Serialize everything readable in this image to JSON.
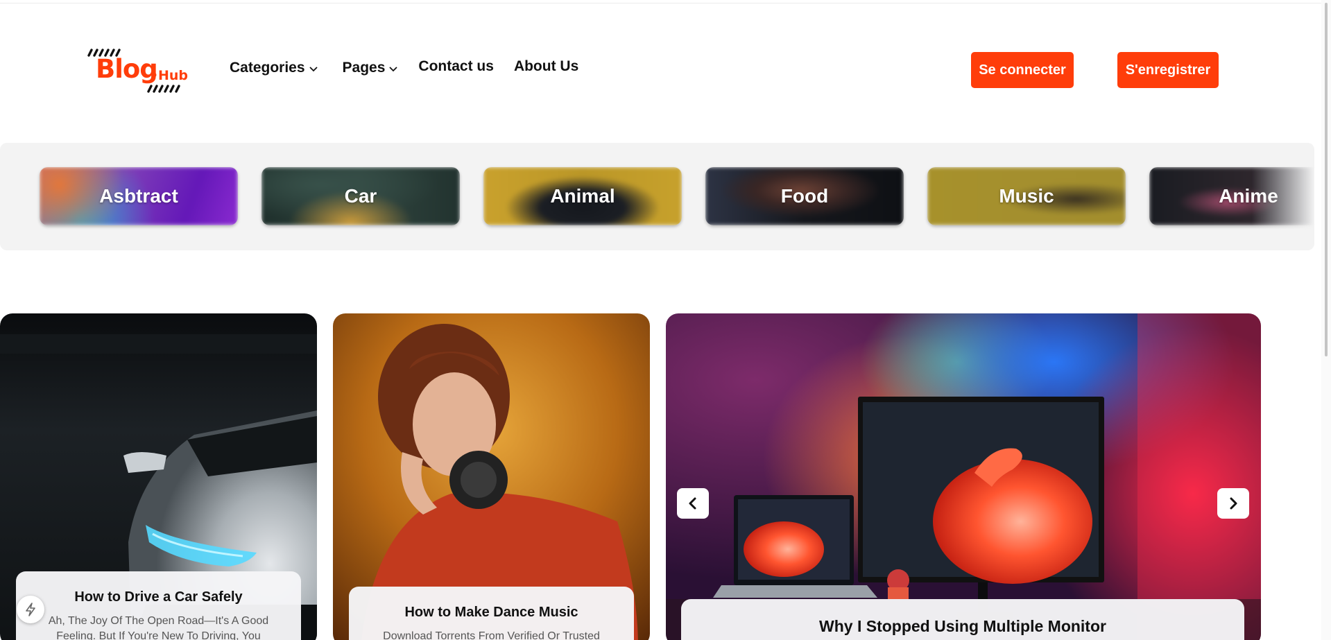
{
  "header": {
    "logo_text_main": "Blog",
    "logo_text_sub": "Hub",
    "nav": [
      {
        "label": "Categories",
        "has_dropdown": true
      },
      {
        "label": "Pages",
        "has_dropdown": true
      },
      {
        "label": "Contact us",
        "has_dropdown": false
      },
      {
        "label": "About Us",
        "has_dropdown": false
      }
    ],
    "login_label": "Se connecter",
    "register_label": "S'enregistrer"
  },
  "categories": [
    {
      "label": "Asbtract",
      "icon": "abstract-thumbnail"
    },
    {
      "label": "Car",
      "icon": "car-thumbnail"
    },
    {
      "label": "Animal",
      "icon": "animal-thumbnail"
    },
    {
      "label": "Food",
      "icon": "food-thumbnail"
    },
    {
      "label": "Music",
      "icon": "music-thumbnail"
    },
    {
      "label": "Anime",
      "icon": "anime-thumbnail"
    }
  ],
  "posts": [
    {
      "title": "How to Drive a Car Safely",
      "excerpt": "Ah, The Joy Of The Open Road—It's A Good Feeling. But If You're New To Driving, You"
    },
    {
      "title": "How to Make Dance Music",
      "excerpt": "Download Torrents From Verified Or Trusted"
    },
    {
      "title": "Why I Stopped Using Multiple Monitor",
      "excerpt": ""
    }
  ],
  "carousel": {
    "prev_icon": "chevron-left-icon",
    "next_icon": "chevron-right-icon"
  },
  "colors": {
    "accent": "#ff3d0a"
  }
}
